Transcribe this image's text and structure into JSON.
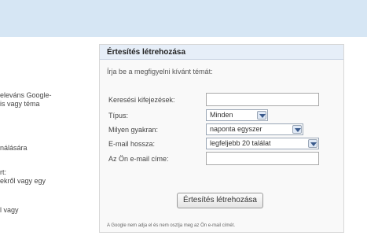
{
  "left_column": {
    "line1": "eleváns Google-",
    "line2": "is vagy téma",
    "line3": "nálására",
    "line4": "rt:",
    "line5": "ekről vagy egy",
    "line6": "l vagy"
  },
  "alert_panel": {
    "title": "Értesítés létrehozása",
    "instruction": "Írja be a megfigyelni kívánt témát:",
    "search_terms": {
      "label": "Keresési kifejezések:",
      "value": ""
    },
    "type": {
      "label": "Típus:",
      "selected": "Minden"
    },
    "frequency": {
      "label": "Milyen gyakran:",
      "selected": "naponta egyszer"
    },
    "email_length": {
      "label": "E-mail hossza:",
      "selected": "legfeljebb 20 találat"
    },
    "email_address": {
      "label": "Az Ön e-mail címe:",
      "value": ""
    },
    "submit_label": "Értesítés létrehozása",
    "footnote": "A Google nem adja el és nem osztja meg az Ön e-mail címét."
  }
}
